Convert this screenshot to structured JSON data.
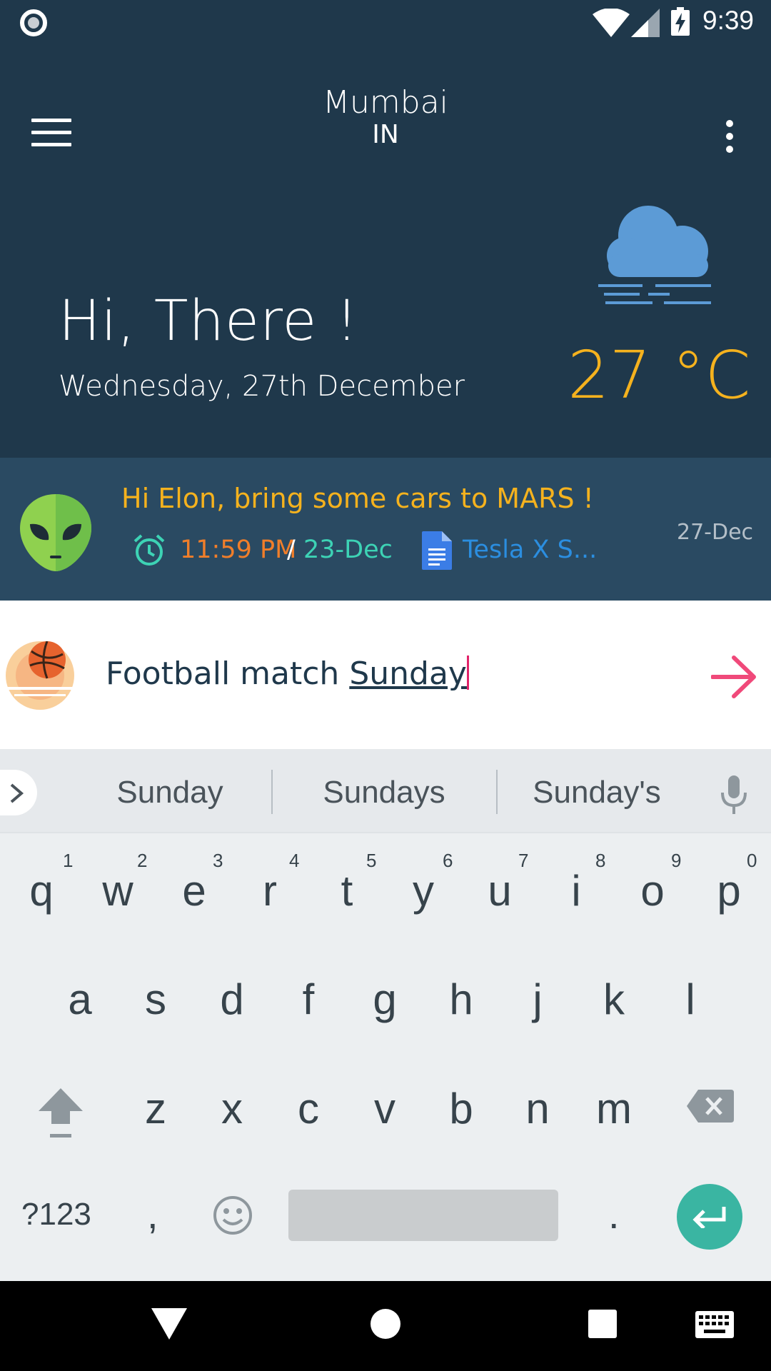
{
  "status_bar": {
    "time": "9:39",
    "icons": [
      "record-icon",
      "wifi-icon",
      "signal-icon",
      "battery-charging-icon"
    ]
  },
  "header": {
    "city": "Mumbai",
    "country": "IN"
  },
  "hero": {
    "greeting": "Hi, There !",
    "date": "Wednesday, 27th December",
    "temperature": "27 °C",
    "weather_icon": "cloud-fog-icon"
  },
  "reminder": {
    "title": "Hi Elon, bring some cars to MARS !",
    "time": "11:59 PM",
    "slash": "/",
    "date": "23-Dec",
    "attachment": "Tesla  X S...",
    "stamp": "27-Dec"
  },
  "input": {
    "text_before": "Football match ",
    "text_underlined": "Sunday"
  },
  "keyboard": {
    "suggestions": [
      "Sunday",
      "Sundays",
      "Sunday's"
    ],
    "row1": [
      "q",
      "w",
      "e",
      "r",
      "t",
      "y",
      "u",
      "i",
      "o",
      "p"
    ],
    "row1_hints": [
      "1",
      "2",
      "3",
      "4",
      "5",
      "6",
      "7",
      "8",
      "9",
      "0"
    ],
    "row2": [
      "a",
      "s",
      "d",
      "f",
      "g",
      "h",
      "j",
      "k",
      "l"
    ],
    "row3": [
      "z",
      "x",
      "c",
      "v",
      "b",
      "n",
      "m"
    ],
    "symbols_label": "?123",
    "comma_label": ",",
    "period_label": "."
  },
  "colors": {
    "background": "#1f384b",
    "card": "#2a4a62",
    "accent_yellow": "#f5b21e",
    "accent_orange": "#f07e2a",
    "accent_teal": "#3dd3b5",
    "link_blue": "#2b8ee0",
    "send_pink": "#f0497a",
    "enter_teal": "#3ab5a2"
  }
}
